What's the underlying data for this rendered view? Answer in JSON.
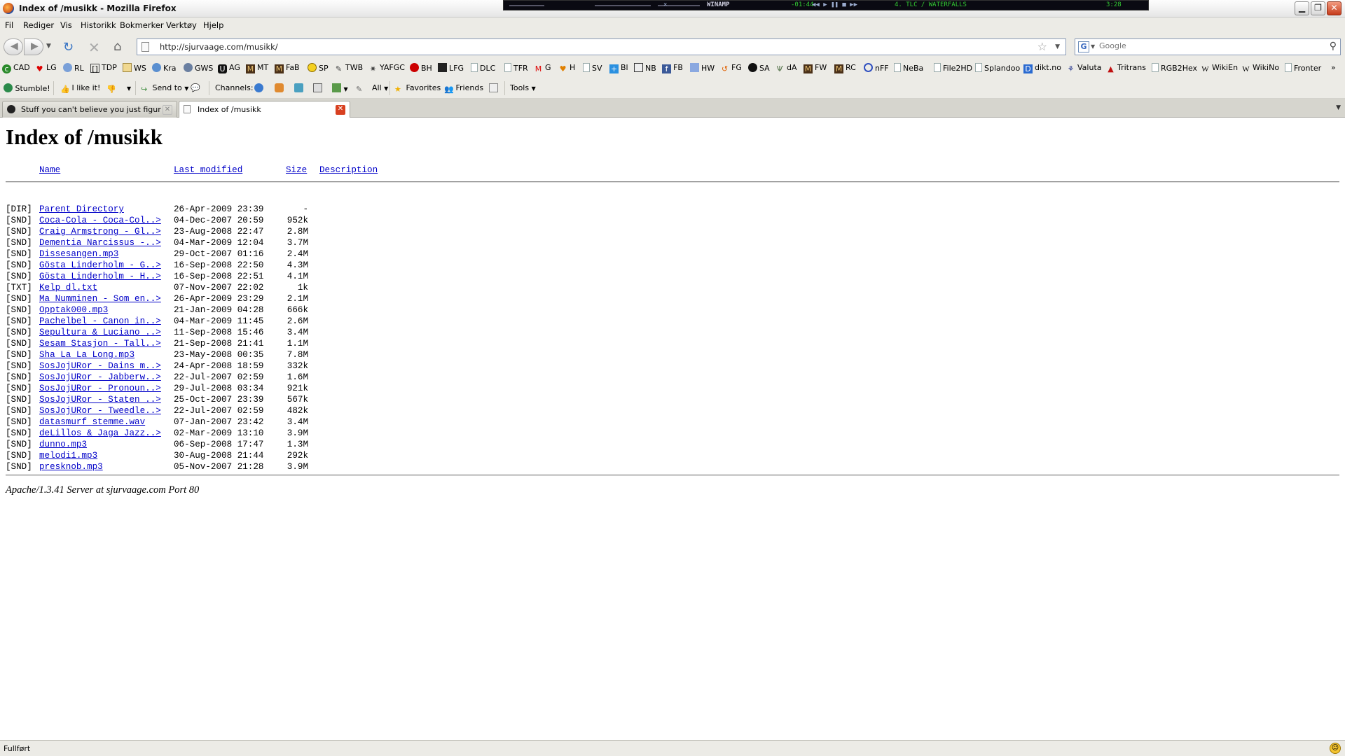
{
  "window": {
    "title": "Index of /musikk - Mozilla Firefox"
  },
  "winamp": {
    "label": "WINAMP",
    "time": "-01:44",
    "track": "4. TLC / WATERFALLS",
    "duration": "3:28"
  },
  "menu": [
    "Fil",
    "Rediger",
    "Vis",
    "Historikk",
    "Bokmerker",
    "Verktøy",
    "Hjelp"
  ],
  "nav": {
    "url": "http://sjurvaage.com/musikk/",
    "search_placeholder": "Google"
  },
  "bookmarks": [
    "CAD",
    "LG",
    "RL",
    "TDP",
    "WS",
    "Kra",
    "GWS",
    "AG",
    "MT",
    "FaB",
    "SP",
    "TWB",
    "YAFGC",
    "BH",
    "LFG",
    "DLC",
    "TFR",
    "G",
    "H",
    "SV",
    "Bl",
    "NB",
    "FB",
    "HW",
    "FG",
    "SA",
    "dA",
    "FW",
    "RC",
    "nFF",
    "NeBa",
    "File2HD",
    "Splandoo",
    "dikt.no",
    "Valuta",
    "Tritrans",
    "RGB2Hex",
    "WikiEn",
    "WikiNo",
    "Fronter"
  ],
  "stumble": {
    "stumble": "Stumble!",
    "like": "I like it!",
    "send_to": "Send to",
    "channels": "Channels:",
    "all": "All",
    "favorites": "Favorites",
    "friends": "Friends",
    "tools": "Tools"
  },
  "tabs": [
    {
      "label": "Stuff you can't believe you just figured...",
      "active": false
    },
    {
      "label": "Index of /musikk",
      "active": true
    }
  ],
  "page": {
    "heading": "Index of /musikk",
    "columns": {
      "name": "Name",
      "modified": "Last modified",
      "size": "Size",
      "description": "Description"
    },
    "rows": [
      {
        "type": "[DIR]",
        "name": "Parent Directory",
        "modified": "26-Apr-2009 23:39",
        "size": "-"
      },
      {
        "type": "[SND]",
        "name": "Coca-Cola - Coca-Col..>",
        "modified": "04-Dec-2007 20:59",
        "size": "952k"
      },
      {
        "type": "[SND]",
        "name": "Craig Armstrong - Gl..>",
        "modified": "23-Aug-2008 22:47",
        "size": "2.8M"
      },
      {
        "type": "[SND]",
        "name": "Dementia Narcissus -..>",
        "modified": "04-Mar-2009 12:04",
        "size": "3.7M"
      },
      {
        "type": "[SND]",
        "name": "Dissesangen.mp3",
        "modified": "29-Oct-2007 01:16",
        "size": "2.4M"
      },
      {
        "type": "[SND]",
        "name": "Gösta Linderholm - G..>",
        "modified": "16-Sep-2008 22:50",
        "size": "4.3M"
      },
      {
        "type": "[SND]",
        "name": "Gösta Linderholm - H..>",
        "modified": "16-Sep-2008 22:51",
        "size": "4.1M"
      },
      {
        "type": "[TXT]",
        "name": "Kelp dl.txt",
        "modified": "07-Nov-2007 22:02",
        "size": "1k"
      },
      {
        "type": "[SND]",
        "name": "Ma Numminen - Som en..>",
        "modified": "26-Apr-2009 23:29",
        "size": "2.1M"
      },
      {
        "type": "[SND]",
        "name": "Opptak000.mp3",
        "modified": "21-Jan-2009 04:28",
        "size": "666k"
      },
      {
        "type": "[SND]",
        "name": "Pachelbel - Canon in..>",
        "modified": "04-Mar-2009 11:45",
        "size": "2.6M"
      },
      {
        "type": "[SND]",
        "name": "Sepultura & Luciano ..>",
        "modified": "11-Sep-2008 15:46",
        "size": "3.4M"
      },
      {
        "type": "[SND]",
        "name": "Sesam Stasjon - Tall..>",
        "modified": "21-Sep-2008 21:41",
        "size": "1.1M"
      },
      {
        "type": "[SND]",
        "name": "Sha La La Long.mp3",
        "modified": "23-May-2008 00:35",
        "size": "7.8M"
      },
      {
        "type": "[SND]",
        "name": "SosJojURor - Dains m..>",
        "modified": "24-Apr-2008 18:59",
        "size": "332k"
      },
      {
        "type": "[SND]",
        "name": "SosJojURor - Jabberw..>",
        "modified": "22-Jul-2007 02:59",
        "size": "1.6M"
      },
      {
        "type": "[SND]",
        "name": "SosJojURor - Pronoun..>",
        "modified": "29-Jul-2008 03:34",
        "size": "921k"
      },
      {
        "type": "[SND]",
        "name": "SosJojURor - Staten ..>",
        "modified": "25-Oct-2007 23:39",
        "size": "567k"
      },
      {
        "type": "[SND]",
        "name": "SosJojURor - Tweedle..>",
        "modified": "22-Jul-2007 02:59",
        "size": "482k"
      },
      {
        "type": "[SND]",
        "name": "datasmurf stemme.wav",
        "modified": "07-Jan-2007 23:42",
        "size": "3.4M"
      },
      {
        "type": "[SND]",
        "name": "deLillos & Jaga Jazz..>",
        "modified": "02-Mar-2009 13:10",
        "size": "3.9M"
      },
      {
        "type": "[SND]",
        "name": "dunno.mp3",
        "modified": "06-Sep-2008 17:47",
        "size": "1.3M"
      },
      {
        "type": "[SND]",
        "name": "melodi1.mp3",
        "modified": "30-Aug-2008 21:44",
        "size": "292k"
      },
      {
        "type": "[SND]",
        "name": "presknob.mp3",
        "modified": "05-Nov-2007 21:28",
        "size": "3.9M"
      }
    ],
    "server_signature": "Apache/1.3.41 Server at sjurvaage.com Port 80"
  },
  "status": {
    "text": "Fullført"
  }
}
